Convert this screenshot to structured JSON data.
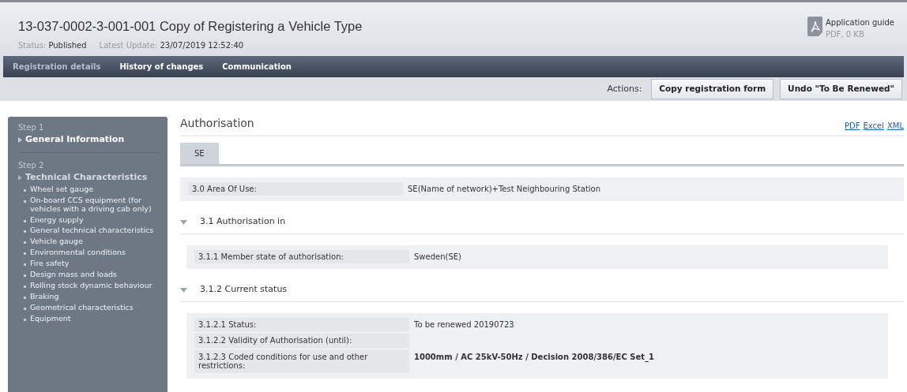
{
  "header": {
    "title": "13-037-0002-3-001-001 Copy of Registering a Vehicle Type",
    "status_label": "Status:",
    "status": "Published",
    "update_label": "Latest Update:",
    "update": "23/07/2019 12:52:40",
    "guide": {
      "title": "Application guide",
      "meta": "PDF, 0 KB"
    }
  },
  "tabs": [
    {
      "label": "Registration details",
      "selected": true
    },
    {
      "label": "History of changes",
      "selected": false
    },
    {
      "label": "Communication",
      "selected": false
    }
  ],
  "actions": {
    "label": "Actions:",
    "buttons": [
      "Copy registration form",
      "Undo \"To Be Renewed\""
    ]
  },
  "sidebar": {
    "steps": [
      {
        "step": "Step 1",
        "title": "General Information",
        "selected": true
      },
      {
        "step": "Step 2",
        "title": "Technical Characteristics",
        "selected": false,
        "items": [
          "Wheel set gauge",
          "On-board CCS equipment (for vehicles with a driving cab only)",
          "Energy supply",
          "General technical characteristics",
          "Vehicle gauge",
          "Environmental conditions",
          "Fire safety",
          "Design mass and loads",
          "Rolling stock dynamic behaviour",
          "Braking",
          "Geometrical characteristics",
          "Equipment"
        ]
      }
    ]
  },
  "section": {
    "title": "Authorisation",
    "exports": [
      "PDF",
      "Excel",
      "XML"
    ],
    "country_tabs": [
      {
        "label": "SE",
        "selected": true
      }
    ],
    "blocks": [
      {
        "kind": "fields",
        "rows": [
          {
            "label": "3.0 Area Of Use:",
            "value": "SE(Name of network)+Test Neighbouring Station",
            "bold": false
          }
        ]
      },
      {
        "kind": "section",
        "title": "3.1 Authorisation in",
        "expanded": true,
        "rows": [
          {
            "label": "3.1.1 Member state of authorisation:",
            "value": "Sweden(SE)",
            "bold": false
          }
        ]
      },
      {
        "kind": "section",
        "title": "3.1.2 Current status",
        "expanded": true,
        "rows": [
          {
            "label": "3.1.2.1 Status:",
            "value": "To be renewed 20190723",
            "bold": false
          },
          {
            "label": "3.1.2.2 Validity of Authorisation (until):",
            "bold": false
          },
          {
            "label": "3.1.2.3 Coded conditions for use and other restrictions:",
            "value": "1000mm / AC 25kV-50Hz / Decision 2008/386/EC Set_1",
            "bold": true
          }
        ]
      }
    ]
  }
}
